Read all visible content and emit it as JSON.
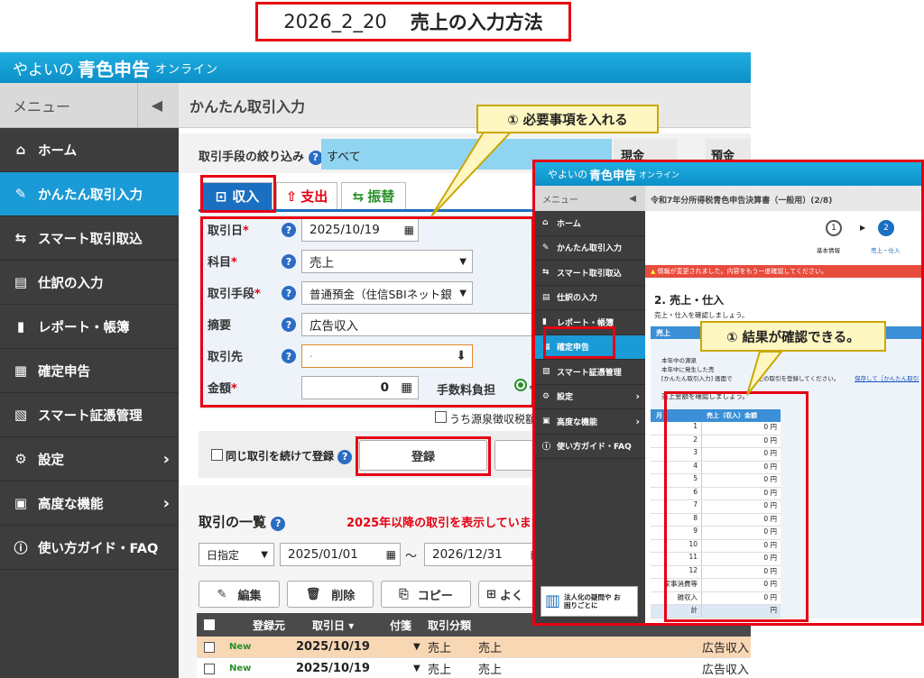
{
  "doc_title": {
    "date": "2026_2_20",
    "text": "売上の入力方法"
  },
  "app": {
    "brand1": "やよいの",
    "brand2": "青色申告",
    "brand3": "オンライン"
  },
  "sidebar": {
    "menu_label": "メニュー",
    "items": [
      {
        "label": "ホーム",
        "icon": "home-icon"
      },
      {
        "label": "かんたん取引入力",
        "icon": "pencil-icon"
      },
      {
        "label": "スマート取引取込",
        "icon": "import-icon"
      },
      {
        "label": "仕訳の入力",
        "icon": "journal-icon"
      },
      {
        "label": "レポート・帳簿",
        "icon": "chart-icon"
      },
      {
        "label": "確定申告",
        "icon": "calculator-icon"
      },
      {
        "label": "スマート証憑管理",
        "icon": "receipt-icon"
      },
      {
        "label": "設定",
        "icon": "gear-icon"
      },
      {
        "label": "高度な機能",
        "icon": "toolbox-icon"
      },
      {
        "label": "使い方ガイド・FAQ",
        "icon": "help-icon"
      }
    ]
  },
  "main": {
    "title": "かんたん取引入力",
    "filter_label": "取引手段の絞り込み",
    "filter_all": "すべて",
    "filter_cash": "現金",
    "filter_deposit": "預金",
    "tabs": {
      "income": "収入",
      "expense": "支出",
      "transfer": "振替"
    },
    "form": {
      "date_label": "取引日",
      "date_value": "2025/10/19",
      "account_label": "科目",
      "account_value": "売上",
      "method_label": "取引手段",
      "method_value": "普通預金（住信SBIネット銀",
      "memo_label": "摘要",
      "memo_value": "広告収入",
      "partner_label": "取引先",
      "partner_value": "-",
      "amount_label": "金額",
      "amount_value": "0",
      "fee_label": "手数料負担",
      "withholding_label": "うち源泉徴収税額"
    },
    "continue_label": "同じ取引を続けて登録",
    "register_label": "登録",
    "list": {
      "title": "取引の一覧",
      "notice": "2025年以降の取引を表示しています",
      "period_mode": "日指定",
      "from": "2025/01/01",
      "tilde": "～",
      "to": "2026/12/31",
      "edit": "編集",
      "delete": "削除",
      "copy": "コピー",
      "frequent": "よく",
      "headers": {
        "source": "登録元",
        "date": "取引日",
        "tag": "付箋",
        "type": "取引分類"
      },
      "rows": [
        {
          "badge": "New",
          "date": "2025/10/19",
          "type": "売上",
          "account": "売上",
          "memo": "広告収入"
        },
        {
          "badge": "New",
          "date": "2025/10/19",
          "type": "売上",
          "account": "売上",
          "memo": "広告収入"
        }
      ]
    }
  },
  "callouts": {
    "one": "① 必要事項を入れる",
    "two": "① 結果が確認できる。"
  },
  "inset": {
    "brand1": "やよいの",
    "brand2": "青色申告",
    "brand3": "オンライン",
    "menu_label": "メニュー",
    "title": "令和7年分所得税青色申告決算書（一般用）(2/8)",
    "steps": {
      "s1": "基本情報",
      "s2": "売上・仕入"
    },
    "warning": "情報が変更されました。内容をもう一度確認してください。",
    "section": "2. 売上・仕入",
    "section_sub": "売上・仕入を確認しましょう。",
    "box_title": "売上",
    "text1": "本年中の源泉",
    "text2": "本年中に発生した売",
    "text3": "[かんたん取引入力] 画面で",
    "text4": "売上の取引を登録してください。",
    "link": "保存して［かんたん取引",
    "confirm": "売上金額を確認しましょう。",
    "th_month": "月",
    "th_value": "売上（収入）金額",
    "months": [
      "1",
      "2",
      "3",
      "4",
      "5",
      "6",
      "7",
      "8",
      "9",
      "10",
      "11",
      "12",
      "家事消費等",
      "雑収入",
      "計"
    ],
    "values": [
      "0 円",
      "0 円",
      "0 円",
      "0 円",
      "0 円",
      "0 円",
      "0 円",
      "0 円",
      "0 円",
      "0 円",
      "0 円",
      "0 円",
      "0 円",
      "0 円",
      "円"
    ],
    "side": [
      "ホーム",
      "かんたん取引入力",
      "スマート取引取込",
      "仕訳の入力",
      "レポート・帳簿",
      "確定申告",
      "スマート証憑管理",
      "設定",
      "高度な機能",
      "使い方ガイド・FAQ"
    ],
    "promo": "法人化の疑問や お困りごとに"
  }
}
